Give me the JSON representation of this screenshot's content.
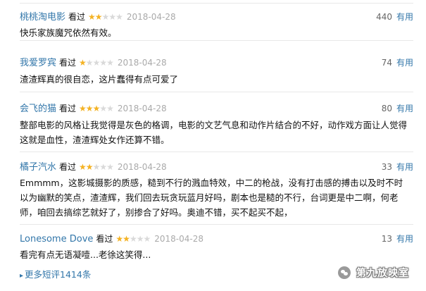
{
  "reviews": [
    {
      "user": "桃桃淘电影",
      "watched": "看过",
      "rating": 2,
      "date": "2018-04-28",
      "votes": "440",
      "useful": "有用",
      "content": "快乐家族魔咒依然有效。"
    },
    {
      "user": "我爱罗宾",
      "watched": "看过",
      "rating": 1,
      "date": "2018-04-28",
      "votes": "74",
      "useful": "有用",
      "content": "渣渣辉真的很自恋，这片蠢得有点可爱了"
    },
    {
      "user": "会飞的猫",
      "watched": "看过",
      "rating": 3,
      "date": "2018-04-28",
      "votes": "80",
      "useful": "有用",
      "content": "整部电影的风格让我觉得是灰色的格调，电影的文艺气息和动作片结合的不好，动作戏方面让人觉得这就是血性，渣渣辉处女作还算不错。"
    },
    {
      "user": "橘子汽水",
      "watched": "看过",
      "rating": 2,
      "date": "2018-04-28",
      "votes": "33",
      "useful": "有用",
      "content": "Emmmm，这影城摄影的质感，糙到不行的溅血特效，中二的枪战，没有打击感的搏击以及时不时以为幽默的笑点，渣渣辉，我们回去玩贪玩蓝月好吗，剧本也是糙的不行，台词更是中二啊，何老师，咱回去搞综艺就好了，别掺合了好吗。奥迪不错，买不起买不起，"
    },
    {
      "user": "Lonesome Dove",
      "watched": "看过",
      "rating": 2,
      "date": "2018-04-28",
      "votes": "13",
      "useful": "有用",
      "content": "看完有点无语凝噎...老徐这笑得..."
    }
  ],
  "more_link": "更多短评1414条",
  "watermark": "第九放映室"
}
